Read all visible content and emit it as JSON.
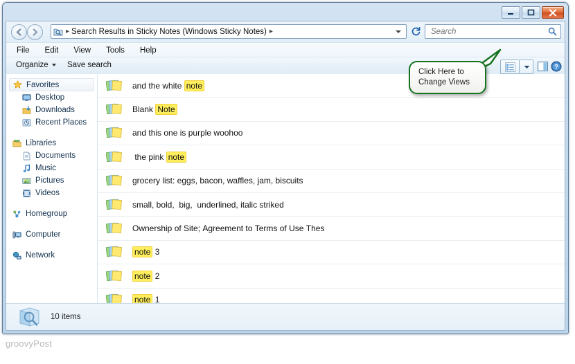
{
  "window": {
    "frame_color": "#bcd4ea",
    "controls": [
      {
        "name": "minimize",
        "label": "Minimize"
      },
      {
        "name": "maximize",
        "label": "Maximize"
      },
      {
        "name": "close",
        "label": "Close"
      }
    ]
  },
  "address_bar": {
    "icon": "search-folder-icon",
    "crumb": "Search Results in Sticky Notes (Windows Sticky Notes)",
    "leading_sep": "▸",
    "trailing_sep": "▸",
    "dropdown_icon": "chevron-down-icon",
    "refresh_icon": "refresh-icon",
    "refresh_glyph": "↻"
  },
  "search": {
    "placeholder": "Search",
    "value": "",
    "icon": "search-icon"
  },
  "menu": {
    "items": [
      {
        "name": "file",
        "label": "File"
      },
      {
        "name": "edit",
        "label": "Edit"
      },
      {
        "name": "view",
        "label": "View"
      },
      {
        "name": "tools",
        "label": "Tools"
      },
      {
        "name": "help",
        "label": "Help"
      }
    ]
  },
  "command_bar": {
    "organize_label": "Organize",
    "save_search_label": "Save search",
    "view_button_icon": "list-view-icon",
    "view_dropdown_icon": "chevron-down-icon",
    "preview_pane_icon": "preview-pane-icon",
    "help_icon": "help-icon"
  },
  "sidebar": {
    "groups": [
      {
        "name": "favorites",
        "header": {
          "label": "Favorites",
          "icon": "star-icon",
          "selected": true
        },
        "items": [
          {
            "label": "Desktop",
            "icon": "desktop-icon"
          },
          {
            "label": "Downloads",
            "icon": "downloads-icon"
          },
          {
            "label": "Recent Places",
            "icon": "recent-places-icon"
          }
        ]
      },
      {
        "name": "libraries",
        "header": {
          "label": "Libraries",
          "icon": "libraries-icon",
          "selected": false
        },
        "items": [
          {
            "label": "Documents",
            "icon": "document-icon"
          },
          {
            "label": "Music",
            "icon": "music-icon"
          },
          {
            "label": "Pictures",
            "icon": "pictures-icon"
          },
          {
            "label": "Videos",
            "icon": "video-icon"
          }
        ]
      },
      {
        "name": "homegroup",
        "header": {
          "label": "Homegroup",
          "icon": "homegroup-icon",
          "selected": false
        },
        "items": []
      },
      {
        "name": "computer",
        "header": {
          "label": "Computer",
          "icon": "computer-icon",
          "selected": false
        },
        "items": []
      },
      {
        "name": "network",
        "header": {
          "label": "Network",
          "icon": "network-icon",
          "selected": false
        },
        "items": []
      }
    ]
  },
  "file_list": {
    "icon": "sticky-note-icon",
    "highlight_color": "#ffef5c",
    "rows": [
      {
        "parts": [
          {
            "t": "and the white ",
            "h": false
          },
          {
            "t": "note",
            "h": true
          }
        ]
      },
      {
        "parts": [
          {
            "t": "Blank ",
            "h": false
          },
          {
            "t": "Note",
            "h": true
          }
        ]
      },
      {
        "parts": [
          {
            "t": "and this one is purple woohoo",
            "h": false
          }
        ]
      },
      {
        "parts": [
          {
            "t": " the pink ",
            "h": false
          },
          {
            "t": "note",
            "h": true
          }
        ]
      },
      {
        "parts": [
          {
            "t": "grocery list: eggs, bacon, waffles, jam, biscuits",
            "h": false
          }
        ]
      },
      {
        "parts": [
          {
            "t": "small, bold,  big,  underlined, italic striked",
            "h": false
          }
        ]
      },
      {
        "parts": [
          {
            "t": "Ownership of Site; Agreement to Terms of Use Thes",
            "h": false
          }
        ]
      },
      {
        "parts": [
          {
            "t": "note",
            "h": true
          },
          {
            "t": " 3",
            "h": false
          }
        ]
      },
      {
        "parts": [
          {
            "t": "note",
            "h": true
          },
          {
            "t": " 2",
            "h": false
          }
        ]
      },
      {
        "parts": [
          {
            "t": "note",
            "h": true
          },
          {
            "t": " 1",
            "h": false
          }
        ]
      }
    ]
  },
  "status_bar": {
    "icon": "search-results-icon",
    "text": "10 items"
  },
  "callout": {
    "line1": "Click Here to",
    "line2": "Change Views",
    "border_color": "#16731f"
  },
  "watermark": {
    "text": "groovyPost"
  }
}
